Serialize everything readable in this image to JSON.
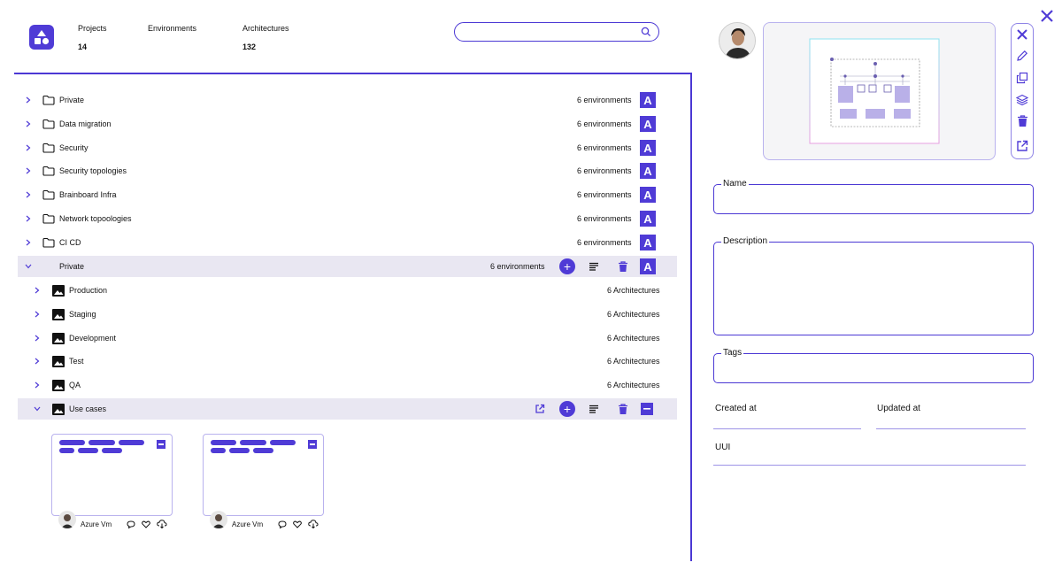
{
  "header": {
    "stats": [
      {
        "label": "Projects",
        "value": "14"
      },
      {
        "label": "Environments",
        "value": ""
      },
      {
        "label": "Architectures",
        "value": "132"
      }
    ],
    "search": {
      "placeholder": ""
    }
  },
  "projects": [
    {
      "name": "Private",
      "count": "6 environments"
    },
    {
      "name": "Data migration",
      "count": "6 environments"
    },
    {
      "name": "Security",
      "count": "6 environments"
    },
    {
      "name": "Security topologies",
      "count": "6 environments"
    },
    {
      "name": "Brainboard Infra",
      "count": "6 environments"
    },
    {
      "name": "Network topoologies",
      "count": "6 environments"
    },
    {
      "name": "CI CD",
      "count": "6 environments"
    }
  ],
  "expanded_project": {
    "name": "Private",
    "count": "6 environments"
  },
  "environments": [
    {
      "name": "Production",
      "count": "6 Architectures"
    },
    {
      "name": "Staging",
      "count": "6 Architectures"
    },
    {
      "name": "Development",
      "count": "6 Architectures"
    },
    {
      "name": "Test",
      "count": "6 Architectures"
    },
    {
      "name": "QA",
      "count": "6 Architectures"
    }
  ],
  "expanded_environment": {
    "name": "Use cases"
  },
  "architectures": [
    {
      "author": "Azure Vm"
    },
    {
      "author": "Azure Vm"
    }
  ],
  "badge_letter": "A",
  "details": {
    "name_label": "Name",
    "description_label": "Description",
    "tags_label": "Tags",
    "created_label": "Created at",
    "updated_label": "Updated at",
    "uuid_label": "UUI"
  },
  "colors": {
    "accent": "#4f3bd6",
    "selected_row": "#e9e7f2"
  }
}
